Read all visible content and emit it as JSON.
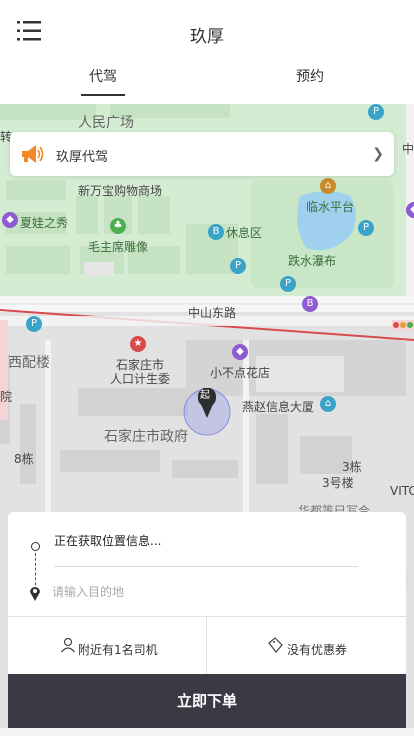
{
  "header": {
    "title": "玖厚"
  },
  "tabs": [
    {
      "label": "代驾",
      "active": true
    },
    {
      "label": "预约",
      "active": false
    }
  ],
  "banner": {
    "text": "玖厚代驾"
  },
  "map": {
    "labels": {
      "people_square": "人民广场",
      "wanfubao": "新万宝购物商场",
      "xiawa": "夏娃之秀",
      "mao_statue": "毛主席雕像",
      "linshui": "临水平台",
      "rest_area": "休息区",
      "waterfall": "跌水瀑布",
      "zhongshan": "中山东路",
      "xipeilou": "西配楼",
      "family_planning_1": "石家庄市",
      "family_planning_2": "人口计生委",
      "xiaobudian": "小不点花店",
      "yanzhao": "燕赵信息大厦",
      "gov": "石家庄市政府",
      "bldg_8": "8栋",
      "bldg_3": "3栋",
      "bldg_3hao": "3号楼",
      "vito": "VITC",
      "bottom_cut": "华都等巳写合",
      "edge_zhuan": "转",
      "edge_zhong": "中",
      "edge_yuan": "院"
    },
    "start_marker": "起",
    "colors": {
      "park": "#d4ecd2",
      "road": "#f6f6f6",
      "block": "#e0e0e0",
      "water": "#9fd1ef",
      "red_road": "#d94b4b"
    }
  },
  "trip": {
    "from_text": "正在获取位置信息...",
    "destination_placeholder": "请输入目的地"
  },
  "info": {
    "drivers": "附近有1名司机",
    "coupons": "没有优惠券"
  },
  "cta": {
    "label": "立即下单"
  },
  "icons": [
    "menu-icon",
    "megaphone-icon",
    "chevron-right-icon",
    "start-pin-icon",
    "locate-icon",
    "person-icon",
    "coupon-icon",
    "destination-pin-icon"
  ]
}
